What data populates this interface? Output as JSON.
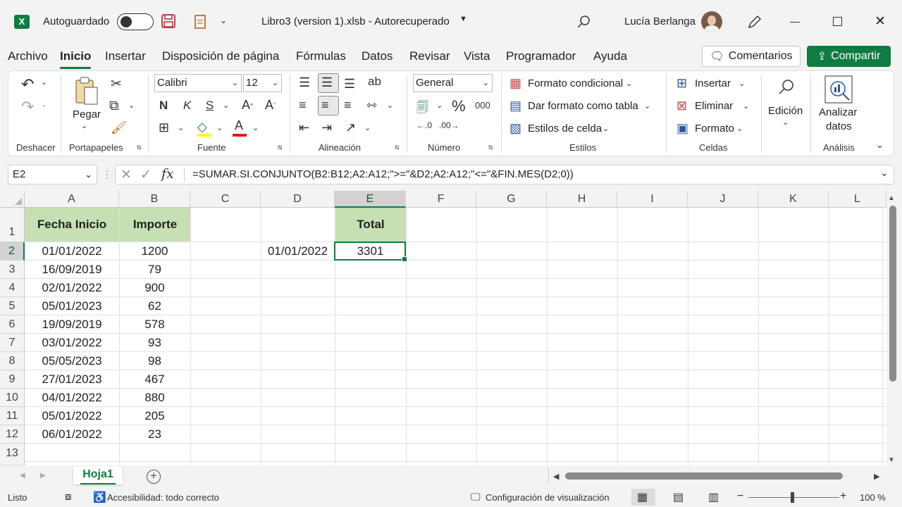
{
  "app": {
    "autosave_label": "Autoguardado",
    "doc_title": "Libro3 (version 1).xlsb  -  Autorecuperado",
    "user_name": "Lucía Berlanga"
  },
  "tabs": [
    "Archivo",
    "Inicio",
    "Insertar",
    "Disposición de página",
    "Fórmulas",
    "Datos",
    "Revisar",
    "Vista",
    "Programador",
    "Ayuda"
  ],
  "actions": {
    "comments": "Comentarios",
    "share": "Compartir"
  },
  "ribbon": {
    "groups": [
      "Deshacer",
      "Portapapeles",
      "Fuente",
      "Alineación",
      "Número",
      "Estilos",
      "Celdas",
      "Análisis"
    ],
    "paste_label": "Pegar",
    "font_name": "Calibri",
    "font_size": "12",
    "number_format": "General",
    "styles": [
      "Formato condicional",
      "Dar formato como tabla",
      "Estilos de celda"
    ],
    "cells": [
      "Insertar",
      "Eliminar",
      "Formato"
    ],
    "editing": "Edición",
    "analyze": [
      "Analizar",
      "datos"
    ]
  },
  "formula_bar": {
    "name_box": "E2",
    "formula": "=SUMAR.SI.CONJUNTO(B2:B12;A2:A12;\">=\"&D2;A2:A12;\"<=\"&FIN.MES(D2;0))"
  },
  "grid": {
    "columns": [
      "A",
      "B",
      "C",
      "D",
      "E",
      "F",
      "G",
      "H",
      "I",
      "J",
      "K",
      "L"
    ],
    "rows": [
      "1",
      "2",
      "3",
      "4",
      "5",
      "6",
      "7",
      "8",
      "9",
      "10",
      "11",
      "12",
      "13"
    ],
    "selected_cell": "E2",
    "header": {
      "A1": "Fecha Inicio",
      "B1": "Importe",
      "E1": "Total"
    },
    "data": [
      [
        "01/01/2022",
        "1200"
      ],
      [
        "16/09/2019",
        "79"
      ],
      [
        "02/01/2022",
        "900"
      ],
      [
        "05/01/2023",
        "62"
      ],
      [
        "19/09/2019",
        "578"
      ],
      [
        "03/01/2022",
        "93"
      ],
      [
        "05/05/2023",
        "98"
      ],
      [
        "27/01/2023",
        "467"
      ],
      [
        "04/01/2022",
        "880"
      ],
      [
        "05/01/2022",
        "205"
      ],
      [
        "06/01/2022",
        "23"
      ]
    ],
    "D2": "01/01/2022",
    "E2": "3301"
  },
  "sheets": {
    "active": "Hoja1"
  },
  "status": {
    "mode": "Listo",
    "accessibility": "Accesibilidad: todo correcto",
    "display_settings": "Configuración de visualización",
    "zoom": "100 %"
  },
  "colors": {
    "accent": "#107c41",
    "header_fill": "#c6e0b4"
  }
}
